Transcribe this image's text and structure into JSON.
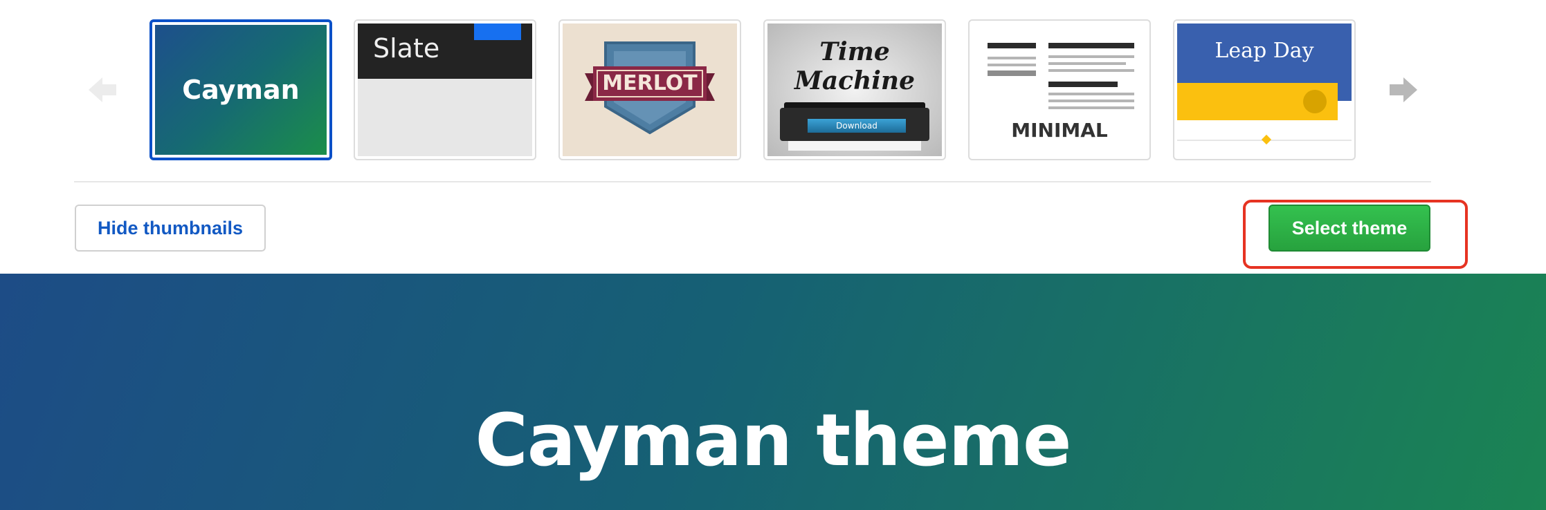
{
  "carousel": {
    "themes": [
      {
        "name": "Cayman",
        "thumb_text": "Cayman",
        "selected": true
      },
      {
        "name": "Slate",
        "thumb_text": "Slate",
        "selected": false
      },
      {
        "name": "Merlot",
        "thumb_text": "MERLOT",
        "selected": false
      },
      {
        "name": "Time Machine",
        "thumb_text": "Time Machine",
        "thumb_button": "Download",
        "selected": false
      },
      {
        "name": "Minimal",
        "thumb_text": "MINIMAL",
        "selected": false
      },
      {
        "name": "Leap Day",
        "thumb_text": "Leap Day",
        "selected": false
      }
    ],
    "prev_icon": "arrow-left-icon",
    "next_icon": "arrow-right-icon"
  },
  "actions": {
    "hide_label": "Hide thumbnails",
    "select_label": "Select theme"
  },
  "hero": {
    "title": "Cayman theme"
  },
  "colors": {
    "selected_border": "#0b50c8",
    "select_button": "#2ea84a",
    "highlight": "#e63322",
    "link": "#1259c3"
  }
}
